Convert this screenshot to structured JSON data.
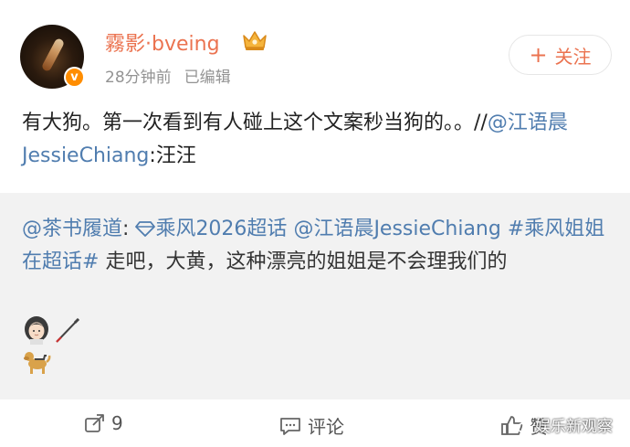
{
  "header": {
    "username": "霧影·bveing",
    "time": "28分钟前",
    "edited": "已编辑",
    "verified_badge": "v",
    "follow_label": "关注",
    "follow_icon": "+"
  },
  "post": {
    "text_plain": "有大狗。第一次看到有人碰上这个文案秒当狗的。。//",
    "mention": "@江语晨JessieChiang",
    "text_tail": ":汪汪"
  },
  "repost": {
    "author": "@茶书履道",
    "colon": ":",
    "topic_icon": "diamond-icon",
    "topic": "乘风2026超话",
    "mention": "@江语晨JessieChiang",
    "hashtag": "#乘风姐姐在超话#",
    "text": "走吧，大黄，这种漂亮的姐姐是不会理我们的",
    "emojis": [
      "woman-icon",
      "white-cane-icon",
      "guide-dog-icon"
    ]
  },
  "actions": {
    "repost_count": "9",
    "comment_label": "评论",
    "like_label": "赞"
  },
  "watermark": "娱乐新观察",
  "colors": {
    "username": "#eb7350",
    "link": "#507daf",
    "repost_bg": "#f2f2f2",
    "vbadge": "#ff8d00"
  }
}
